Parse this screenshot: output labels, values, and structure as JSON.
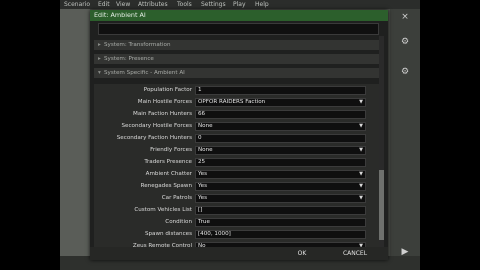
{
  "menu": [
    "Scenario",
    "Edit",
    "View",
    "Attributes",
    "Tools",
    "Settings",
    "Play",
    "Help"
  ],
  "dialog": {
    "title": "Edit: Ambient AI",
    "sections": [
      "System: Transformation",
      "System: Presence",
      "System Specific - Ambient AI"
    ],
    "fields": [
      {
        "label": "Population Factor",
        "value": "1",
        "dropdown": false
      },
      {
        "label": "Main Hostile Forces",
        "value": "OPFOR RAIDERS Faction",
        "dropdown": true
      },
      {
        "label": "Main Faction Hunters",
        "value": "66",
        "dropdown": false
      },
      {
        "label": "Secondary Hostile Forces",
        "value": "None",
        "dropdown": true
      },
      {
        "label": "Secondary Faction Hunters",
        "value": "0",
        "dropdown": false
      },
      {
        "label": "Friendly Forces",
        "value": "None",
        "dropdown": true
      },
      {
        "label": "Traders Presence",
        "value": "25",
        "dropdown": false
      },
      {
        "label": "Ambient Chatter",
        "value": "Yes",
        "dropdown": true
      },
      {
        "label": "Renegades Spawn",
        "value": "Yes",
        "dropdown": true
      },
      {
        "label": "Car Patrols",
        "value": "Yes",
        "dropdown": true
      },
      {
        "label": "Custom Vehicles List",
        "value": "[]",
        "dropdown": false
      },
      {
        "label": "Condition",
        "value": "True",
        "dropdown": false
      },
      {
        "label": "Spawn distances",
        "value": "[400, 1000]",
        "dropdown": false
      },
      {
        "label": "Zeus Remote Control",
        "value": "No",
        "dropdown": true
      }
    ],
    "ok_label": "OK",
    "cancel_label": "CANCEL"
  },
  "icons": {
    "chevron": "chevron-down-icon",
    "section_arrow": "triangle-right-icon"
  },
  "colors": {
    "titlebar": "#2c5f2c",
    "dialog_bg": "#1f201f",
    "field_bg": "#0f0f0f"
  }
}
